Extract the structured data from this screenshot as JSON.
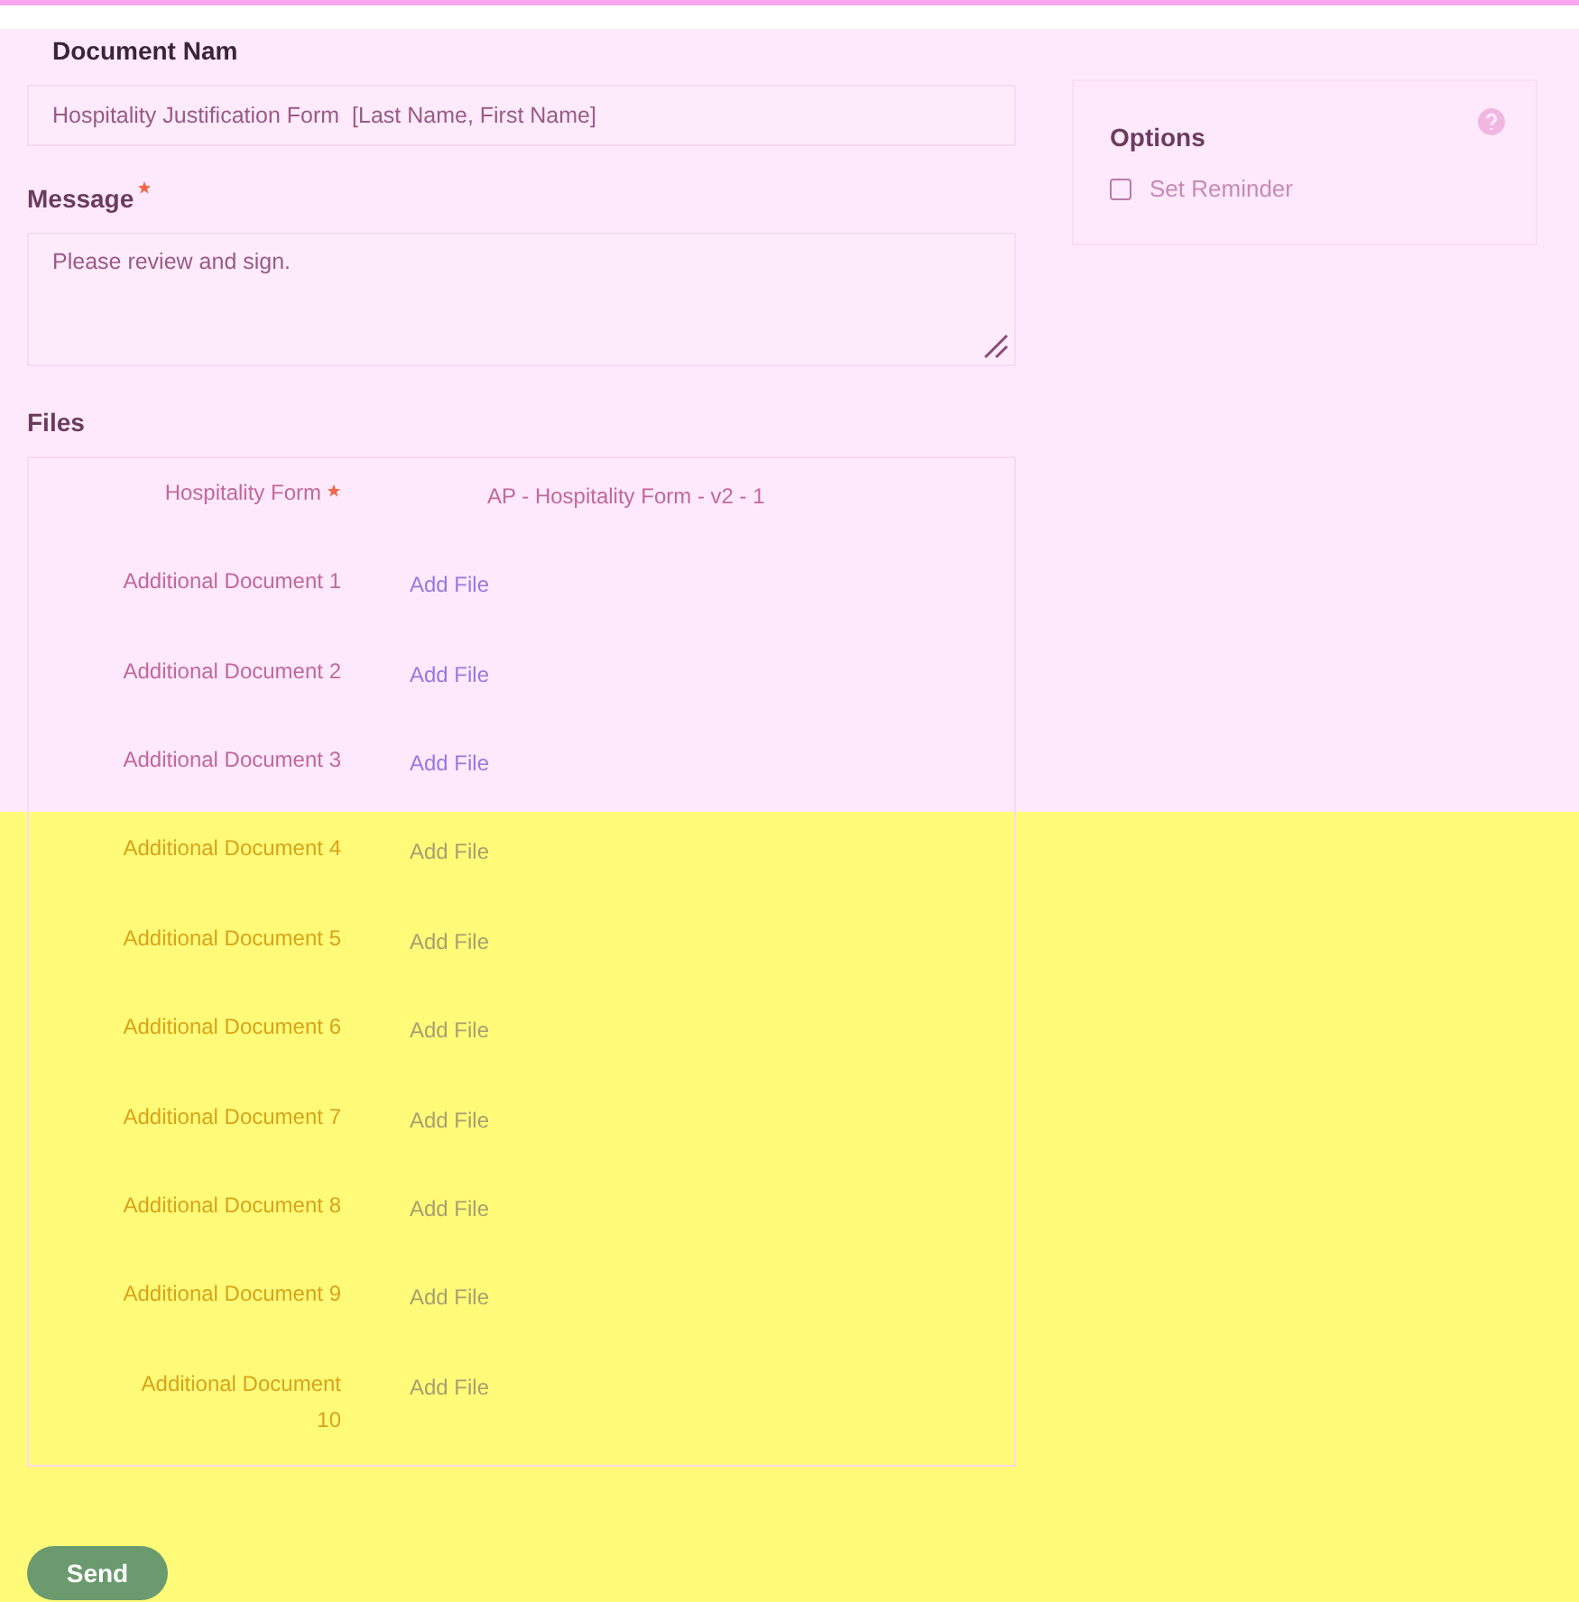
{
  "document_name": {
    "label": "Document Nam",
    "value": "Hospitality Justification Form  [Last Name, First Name]"
  },
  "message": {
    "label": "Message",
    "required": true,
    "value": "Please review and sign."
  },
  "files": {
    "label": "Files",
    "rows": [
      {
        "kind": "attached",
        "label": "Hospitality Form",
        "required": true,
        "file": "AP - Hospitality Form - v2 - 1"
      },
      {
        "kind": "empty",
        "label": "Additional Document 1",
        "required": false,
        "action": "Add File"
      },
      {
        "kind": "empty",
        "label": "Additional Document 2",
        "required": false,
        "action": "Add File"
      },
      {
        "kind": "empty",
        "label": "Additional Document 3",
        "required": false,
        "action": "Add File"
      },
      {
        "kind": "empty",
        "label": "Additional Document 4",
        "required": false,
        "action": "Add File"
      },
      {
        "kind": "empty",
        "label": "Additional Document 5",
        "required": false,
        "action": "Add File"
      },
      {
        "kind": "empty",
        "label": "Additional Document 6",
        "required": false,
        "action": "Add File"
      },
      {
        "kind": "empty",
        "label": "Additional Document 7",
        "required": false,
        "action": "Add File"
      },
      {
        "kind": "empty",
        "label": "Additional Document 8",
        "required": false,
        "action": "Add File"
      },
      {
        "kind": "empty",
        "label": "Additional Document 9",
        "required": false,
        "action": "Add File"
      },
      {
        "kind": "empty",
        "label": "Additional Document 10",
        "required": false,
        "action": "Add File"
      }
    ]
  },
  "options": {
    "title": "Options",
    "items": [
      {
        "label": "Set Reminder",
        "checked": false
      }
    ]
  },
  "send_button": "Send"
}
